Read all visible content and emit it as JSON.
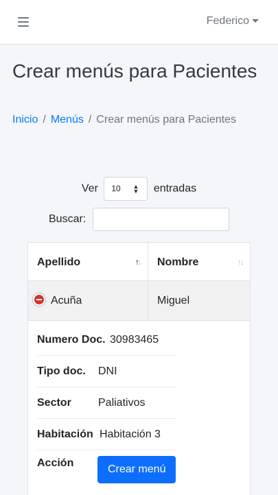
{
  "navbar": {
    "menu_icon": "hamburger-icon",
    "user_name": "Federico",
    "user_caret_icon": "caret-down-icon"
  },
  "page": {
    "title": "Crear menús para Pacientes"
  },
  "breadcrumb": {
    "items": [
      "Inicio",
      "Menús",
      "Crear menús para Pacientes"
    ],
    "separator": "/"
  },
  "table_controls": {
    "length_label_before": "Ver",
    "length_value": "10",
    "length_label_after": "entradas",
    "search_label": "Buscar:",
    "search_value": ""
  },
  "table": {
    "columns": [
      "Apellido",
      "Nombre"
    ],
    "rows": [
      {
        "apellido": "Acuña",
        "nombre": "Miguel",
        "expanded": true,
        "details": [
          {
            "label": "Numero Doc.",
            "value": "30983465"
          },
          {
            "label": "Tipo doc.",
            "value": "DNI"
          },
          {
            "label": "Sector",
            "value": "Paliativos"
          },
          {
            "label": "Habitación",
            "value": "Habitación 3"
          },
          {
            "label": "Acción",
            "button": "Crear menú"
          }
        ]
      }
    ]
  },
  "colors": {
    "link": "#007bff",
    "primary_button": "#0d6efd",
    "collapse_button": "#d33333",
    "background": "#f4f6f9"
  }
}
